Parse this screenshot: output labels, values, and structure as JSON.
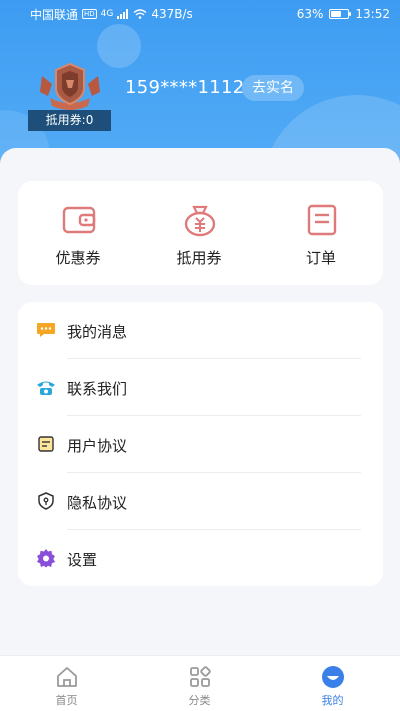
{
  "status_bar": {
    "carrier": "中国联通",
    "hd": "HD",
    "signal": "4G",
    "net_speed": "437B/s",
    "battery_text": "63%",
    "battery_level": 0.63,
    "time": "13:52"
  },
  "profile": {
    "phone": "159****1112",
    "realname_label": "去实名",
    "voucher_tag": "抵用券:0"
  },
  "shortcuts": [
    {
      "label": "优惠券",
      "icon": "wallet-icon"
    },
    {
      "label": "抵用券",
      "icon": "money-bag-icon"
    },
    {
      "label": "订单",
      "icon": "order-icon"
    }
  ],
  "menu": [
    {
      "label": "我的消息",
      "icon": "message-icon"
    },
    {
      "label": "联系我们",
      "icon": "phone-icon"
    },
    {
      "label": "用户协议",
      "icon": "note-icon"
    },
    {
      "label": "隐私协议",
      "icon": "shield-icon"
    },
    {
      "label": "设置",
      "icon": "gear-icon"
    }
  ],
  "tabbar": [
    {
      "label": "首页",
      "icon": "home-icon"
    },
    {
      "label": "分类",
      "icon": "grid-icon"
    },
    {
      "label": "我的",
      "icon": "user-icon",
      "active": true
    }
  ],
  "colors": {
    "header": "#3d9cf2",
    "accent_icon": "#e07a7a",
    "active_tab": "#3b7fe8"
  }
}
